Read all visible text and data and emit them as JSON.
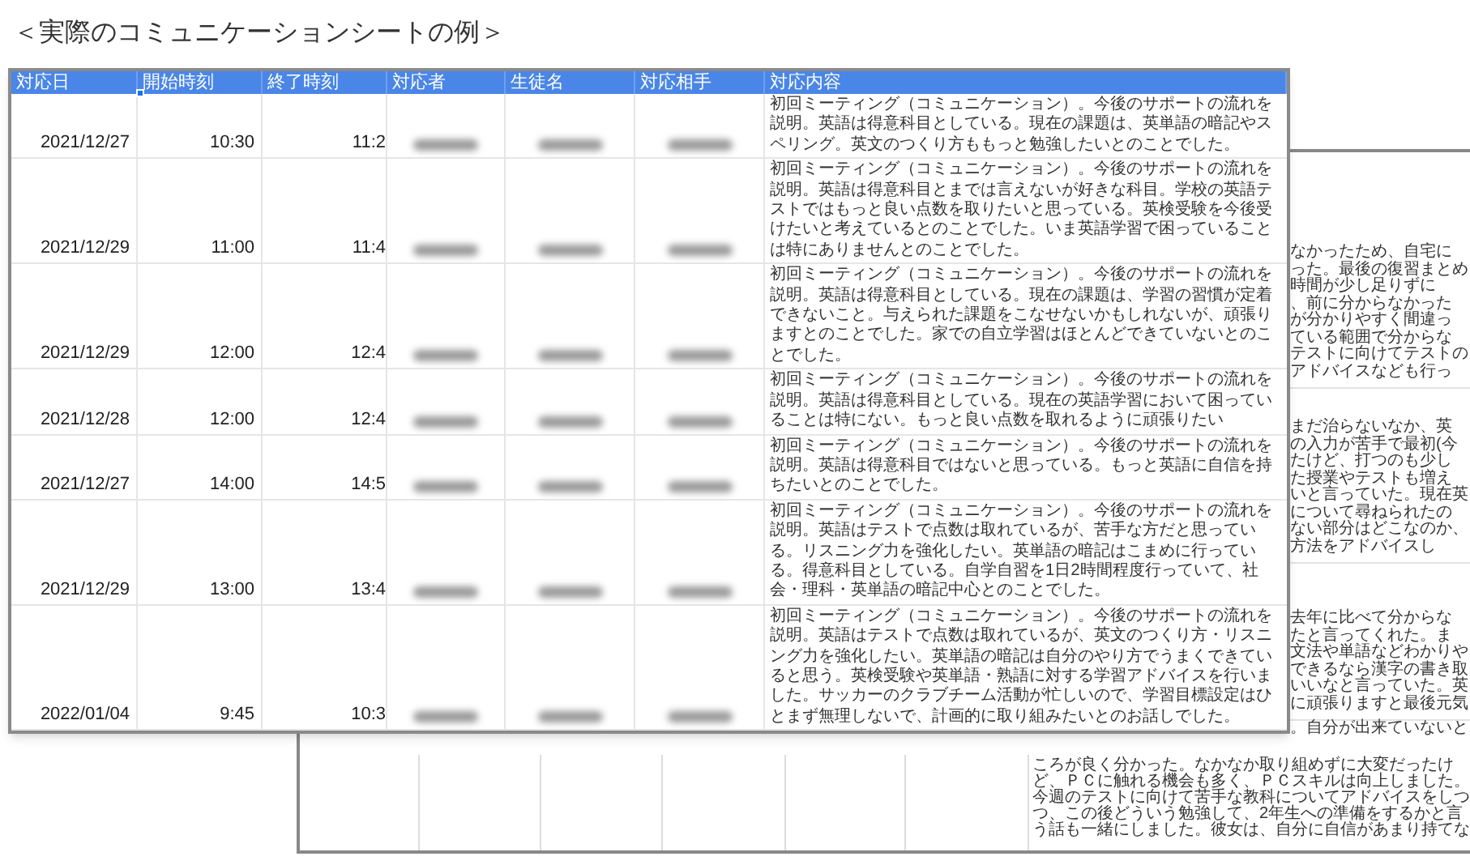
{
  "title": "＜実際のコミュニケーションシートの例＞",
  "back_sheet": {
    "side_cells": [
      {
        "lines": [
          "なかったため、自宅に",
          "った。最後の復習まとめ",
          "時間が少し足りずに",
          "、前に分からなかった",
          "が分かりやすく間違っ",
          "ている範囲で分からな",
          "テストに向けてテストの",
          "アドバイスなども行っ"
        ]
      },
      {
        "lines": [
          "まだ治らないなか、英",
          "の入力が苦手で最初(今",
          "たけど、打つのも少し",
          "た授業やテストも増え",
          "いと言っていた。現在英",
          "について尋ねられたの",
          "ない部分はどこなのか、",
          "方法をアドバイスし"
        ]
      },
      {
        "lines": [
          "去年に比べて分からな",
          "たと言ってくれた。ま",
          "文法や単語などわかりや",
          "できるなら漢字の書き取",
          "いいなと言っていた。英",
          "に頑張りますと最後元気"
        ]
      },
      {
        "lines": [
          "。自分が出来ていないと"
        ]
      }
    ],
    "bottom_lines": [
      "ころが良く分かった。なかなか取り組めずに大変だったけ",
      "ど、ＰＣに触れる機会も多く、ＰＣスキルは向上しました。",
      "今週のテストに向けて苦手な教科についてアドバイスをしつ",
      "つ、この後どういう勉強して、2年生への準備をするかと言",
      "う話も一緒にしました。彼女は、自分に自信があまり持てな"
    ]
  },
  "sheet": {
    "columns": [
      "対応日",
      "開始時刻",
      "終了時刻",
      "対応者",
      "生徒名",
      "対応相手",
      "対応内容"
    ],
    "rows": [
      {
        "date": "2021/12/27",
        "start": "10:30",
        "end": "11:2",
        "content": "初回ミーティング（コミュニケーション）。今後のサポートの流れを説明。英語は得意科目としている。現在の課題は、英単語の暗記やスペリング。英文のつくり方ももっと勉強したいとのことでした。"
      },
      {
        "date": "2021/12/29",
        "start": "11:00",
        "end": "11:4",
        "content": "初回ミーティング（コミュニケーション）。今後のサポートの流れを説明。英語は得意科目とまでは言えないが好きな科目。学校の英語テストではもっと良い点数を取りたいと思っている。英検受験を今後受けたいと考えているとのことでした。いま英語学習で困っていることは特にありませんとのことでした。"
      },
      {
        "date": "2021/12/29",
        "start": "12:00",
        "end": "12:4",
        "content": "初回ミーティング（コミュニケーション）。今後のサポートの流れを説明。英語は得意科目としている。現在の課題は、学習の習慣が定着できないこと。与えられた課題をこなせないかもしれないが、頑張りますとのことでした。家での自立学習はほとんどできていないとのことでした。"
      },
      {
        "date": "2021/12/28",
        "start": "12:00",
        "end": "12:4",
        "content": "初回ミーティング（コミュニケーション）。今後のサポートの流れを説明。英語は得意科目としている。現在の英語学習において困っていることは特にない。もっと良い点数を取れるように頑張りたい"
      },
      {
        "date": "2021/12/27",
        "start": "14:00",
        "end": "14:5",
        "content": "初回ミーティング（コミュニケーション）。今後のサポートの流れを説明。英語は得意科目ではないと思っている。もっと英語に自信を持ちたいとのことでした。"
      },
      {
        "date": "2021/12/29",
        "start": "13:00",
        "end": "13:4",
        "content": "初回ミーティング（コミュニケーション）。今後のサポートの流れを説明。英語はテストで点数は取れているが、苦手な方だと思っている。リスニング力を強化したい。英単語の暗記はこまめに行っている。得意科目としている。自学自習を1日2時間程度行っていて、社会・理科・英単語の暗記中心とのことでした。"
      },
      {
        "date": "2022/01/04",
        "start": "9:45",
        "end": "10:3",
        "content": "初回ミーティング（コミュニケーション）。今後のサポートの流れを説明。英語はテストで点数は取れているが、英文のつくり方・リスニング力を強化したい。英単語の暗記は自分のやり方でうまくできていると思う。英検受験や英単語・熟語に対する学習アドバイスを行いました。サッカーのクラブチーム活動が忙しいので、学習目標設定はひとまず無理しないで、計画的に取り組みたいとのお話しでした。"
      }
    ]
  }
}
